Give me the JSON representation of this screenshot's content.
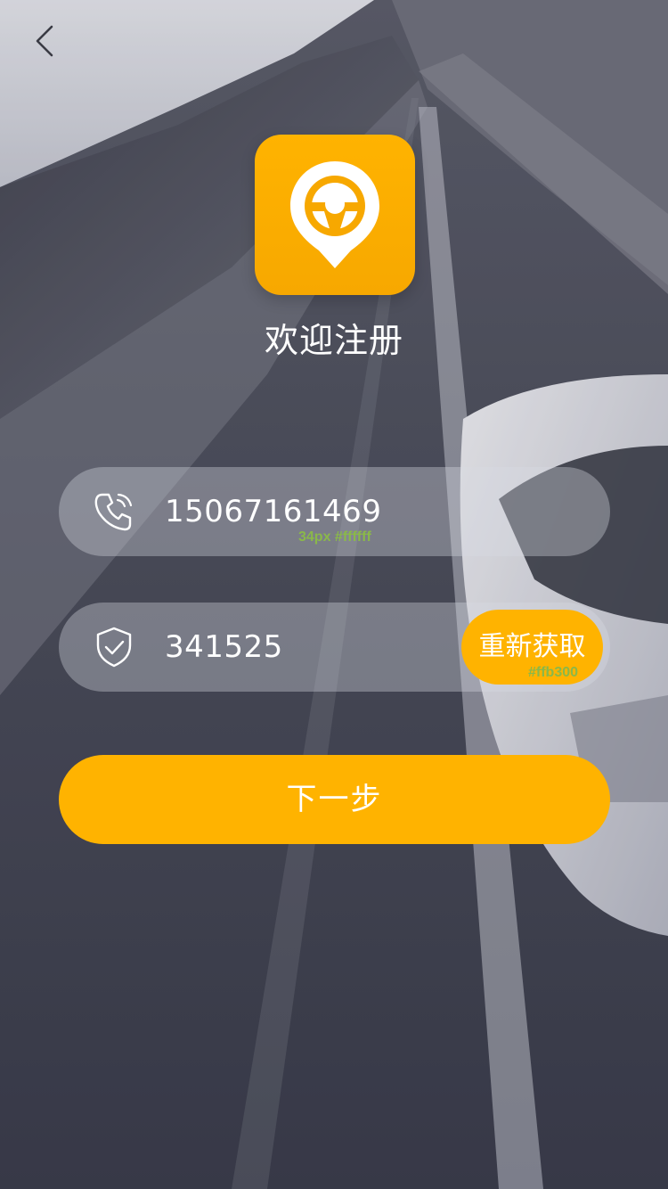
{
  "header": {
    "back_icon": "chevron-left-icon"
  },
  "logo": {
    "icon": "steering-wheel-pin-icon",
    "color": "#ffb300"
  },
  "page": {
    "title": "欢迎注册"
  },
  "form": {
    "phone": {
      "icon": "phone-icon",
      "value": "15067161469",
      "annotation": "34px #ffffff"
    },
    "code": {
      "icon": "shield-check-icon",
      "value": "341525",
      "resend_label": "重新获取",
      "annotation": "#ffb300"
    },
    "next_label": "下一步"
  },
  "colors": {
    "accent": "#ffb300",
    "text": "#ffffff",
    "annotation": "#8ab84a"
  }
}
